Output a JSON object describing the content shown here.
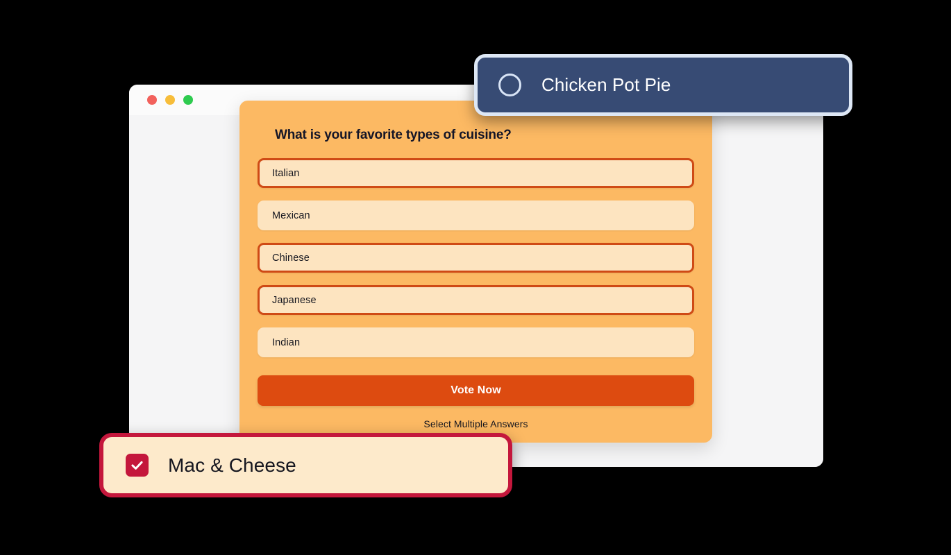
{
  "browser": {
    "traffic_lights": [
      {
        "name": "close",
        "color": "#f2615c"
      },
      {
        "name": "minimize",
        "color": "#f7bd3a"
      },
      {
        "name": "maximize",
        "color": "#2ecb4f"
      }
    ]
  },
  "poll": {
    "question": "What is your favorite types of cuisine?",
    "options": [
      {
        "label": "Italian",
        "selected": true
      },
      {
        "label": "Mexican",
        "selected": false
      },
      {
        "label": "Chinese",
        "selected": true
      },
      {
        "label": "Japanese",
        "selected": true
      },
      {
        "label": "Indian",
        "selected": false
      }
    ],
    "vote_button_label": "Vote Now",
    "helper_text": "Select Multiple Answers",
    "colors": {
      "card_background": "#fcb963",
      "option_background": "#fde4c0",
      "option_selected_border": "#cf4a15",
      "button_background": "#dd4b10",
      "button_text": "#ffffff",
      "text": "#15161f"
    }
  },
  "floating_chips": [
    {
      "id": "chicken-pot-pie",
      "label": "Chicken Pot Pie",
      "control": "radio",
      "checked": false,
      "colors": {
        "background": "#374b74",
        "border": "#dde7f5",
        "text": "#ffffff"
      }
    },
    {
      "id": "mac-and-cheese",
      "label": "Mac & Cheese",
      "control": "checkbox",
      "checked": true,
      "colors": {
        "background": "#fdeacb",
        "border": "#c4173c",
        "text": "#15161f"
      }
    }
  ],
  "page": {
    "background": "#000000"
  }
}
